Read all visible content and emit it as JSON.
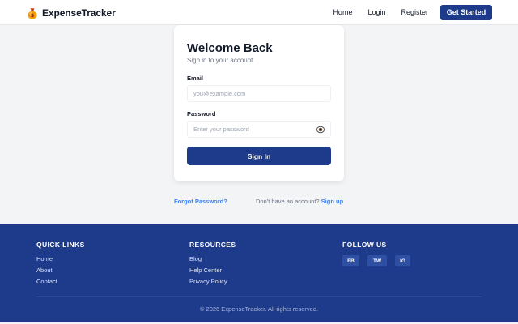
{
  "header": {
    "brand_name": "ExpenseTracker",
    "brand_icon": "money-bag-icon",
    "nav": [
      "Home",
      "Login",
      "Register"
    ],
    "cta_label": "Get Started"
  },
  "login": {
    "title": "Welcome Back",
    "subtitle": "Sign in to your account",
    "email_label": "Email",
    "email_placeholder": "you@example.com",
    "password_label": "Password",
    "password_placeholder": "Enter your password",
    "password_toggle_icon": "eye-icon",
    "submit_label": "Sign In"
  },
  "links": {
    "forgot": "Forgot Password?",
    "no_account": "Don't have an account?",
    "signup": "Sign up"
  },
  "footer": {
    "quick_links": {
      "heading": "QUICK LINKS",
      "items": [
        "Home",
        "About",
        "Contact"
      ]
    },
    "resources": {
      "heading": "RESOURCES",
      "items": [
        "Blog",
        "Help Center",
        "Privacy Policy"
      ]
    },
    "follow": {
      "heading": "FOLLOW US",
      "items": [
        "FB",
        "TW",
        "IG"
      ]
    },
    "copyright": "© 2026 ExpenseTracker. All rights reserved."
  },
  "colors": {
    "primary": "#1e3a8a",
    "link": "#3b82f6",
    "background": "#f3f4f6"
  }
}
